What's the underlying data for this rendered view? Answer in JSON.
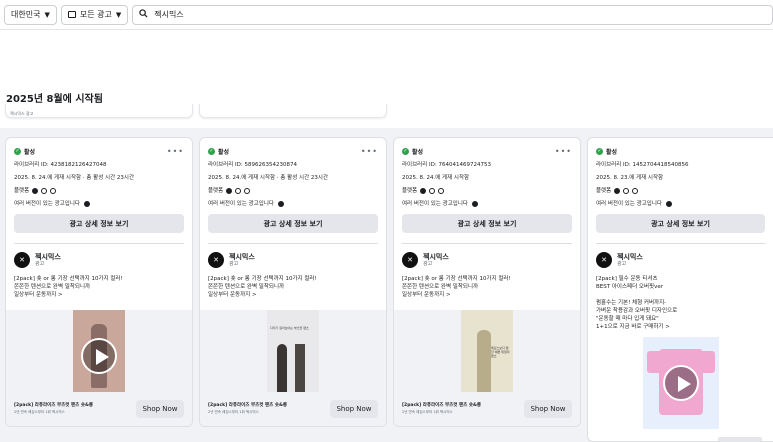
{
  "filters": {
    "country": "대한민국",
    "ad_category": "모든 광고",
    "search_value": "젝시믹스"
  },
  "section_heading": "2025년 8월에 시작됨",
  "stub_text": "젝시믹스 광고",
  "cards": [
    {
      "status": "활성",
      "library_id": "라이브러리 ID: 4238182126427048",
      "run_info": "2025. 8. 24.에 게재 시작함 · 총 활성 시간 23시간",
      "platform_label": "플랫폼",
      "variants_text": "여러 버전이 있는 광고입니다",
      "detail_button": "광고 상세 정보 보기",
      "advertiser": "젝시믹스",
      "sponsored": "광고",
      "body": "[2pack] 숏 or 롱 기장 선택까지 10가지 컬러!\n쫀쫀한 텐션으로 완벽 밀착되니까\n일상부터 운동까지 >",
      "footer_title": "[2pack] 라퓨라이즈 부츠컷 팬츠 숏&롱",
      "footer_sub": "2년 연속 레깅스부터 1위 젝시믹스",
      "cta": "Shop Now"
    },
    {
      "status": "활성",
      "library_id": "라이브러리 ID: 589626354230874",
      "run_info": "2025. 8. 24.에 게재 시작함 · 총 활성 시간 23시간",
      "platform_label": "플랫폼",
      "variants_text": "여러 버전이 있는 광고입니다",
      "detail_button": "광고 상세 정보 보기",
      "advertiser": "젝시믹스",
      "sponsored": "광고",
      "body": "[2pack] 숏 or 롱 기장 선택까지 10가지 컬러!\n쫀쫀한 텐션으로 완벽 밀착되니까\n일상부터 운동까지 >",
      "footer_title": "[2pack] 라퓨라이즈 부츠컷 팬츠 숏&롱",
      "footer_sub": "2년 연속 레깅스부터 1위 젝시믹스",
      "cta": "Shop Now"
    },
    {
      "status": "활성",
      "library_id": "라이브러리 ID: 764041469724753",
      "run_info": "2025. 8. 24.에 게재 시작함",
      "platform_label": "플랫폼",
      "variants_text": "여러 버전이 있는 광고입니다",
      "detail_button": "광고 상세 정보 보기",
      "advertiser": "젝시믹스",
      "sponsored": "광고",
      "body": "[2pack] 숏 or 롱 기장 선택까지 10가지 컬러!\n쫀쫀한 텐션으로 완벽 밀착되니까\n일상부터 운동까지 >",
      "footer_title": "[2pack] 라퓨라이즈 부츠컷 팬츠 숏&롱",
      "footer_sub": "2년 연속 레깅스부터 1위 젝시믹스",
      "cta": "Shop Now"
    },
    {
      "status": "활성",
      "library_id": "라이브러리 ID: 1452704418540856",
      "run_info": "2025. 8. 23.에 게재 시작함",
      "platform_label": "플랫폼",
      "variants_text": "여러 버전이 있는 광고입니다",
      "detail_button": "광고 상세 정보 보기",
      "advertiser": "젝시믹스",
      "sponsored": "광고",
      "body": "[2pack] 필수 운동 티셔츠\nBEST 아이스페더 오버핏ver\n\n펌홀수는 기본! 체형 커버까지-\n가벼운 착용감과 오버핏 디자인으로\n\"운동할 때 마다 입게 돼요\"\n1+1으로 지금 바로 구매하기 >"
    }
  ],
  "media_captions": {
    "card2": "다리가 길어보이는 부츠컷 팬츠",
    "card3": "레깅스보다 편한 예쁜 데일리 팬츠"
  }
}
